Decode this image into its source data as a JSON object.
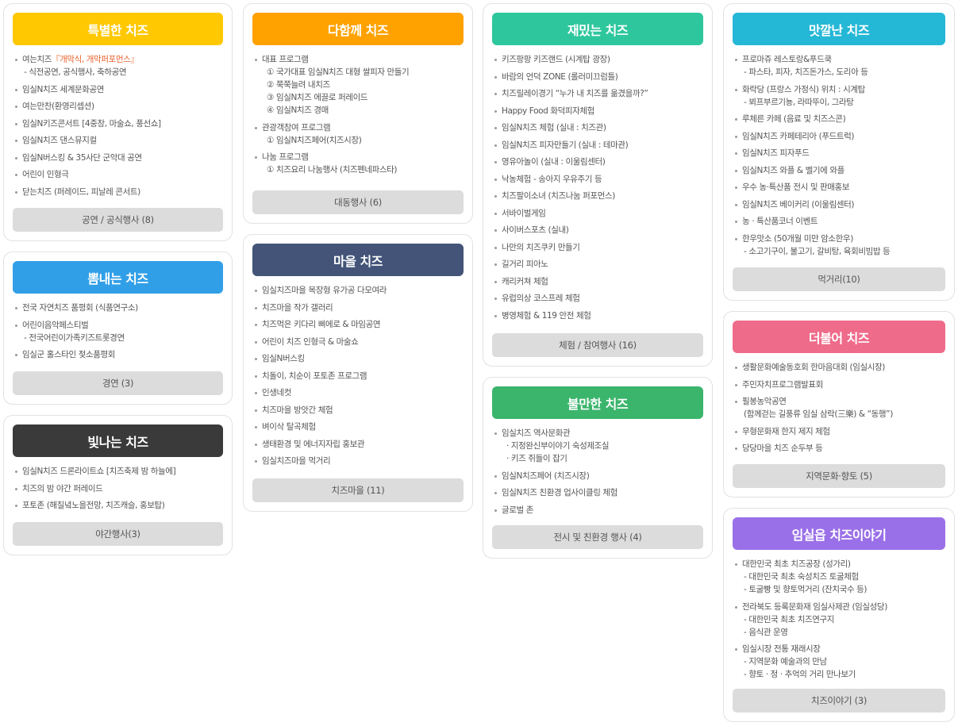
{
  "cards": [
    {
      "id": "special",
      "title": "특별한 치즈",
      "color": "#ffc800",
      "items": [
        {
          "text": "여는치즈",
          "highlight": "『개막식, 개막퍼포먼스』",
          "subs": [
            "- 식전공연, 공식행사, 축하공연"
          ]
        },
        {
          "text": "임실N치즈 세계문화공연"
        },
        {
          "text": "여는만찬(환영리셉션)"
        },
        {
          "text": "임실N키즈콘서트 [4중창, 마술쇼, 풍선쇼]"
        },
        {
          "text": "임실N치즈 댄스뮤지컬"
        },
        {
          "text": "임실N버스킹 & 35사단 군악대 공연"
        },
        {
          "text": "어린이 인형극"
        },
        {
          "text": "닫는치즈 (퍼레이드, 피날레 콘서트)"
        }
      ],
      "button": "공연 / 공식행사 (8)"
    },
    {
      "id": "boast",
      "title": "뽐내는 치즈",
      "color": "#319fe8",
      "items": [
        {
          "text": "전국 자연치즈 품평회 (식품연구소)"
        },
        {
          "text": "어린이음악페스티벌",
          "subs": [
            "- 전국어린이가족키즈트롯경연"
          ]
        },
        {
          "text": "임실군 홀스타인 젖소품평회"
        }
      ],
      "button": "경연 (3)"
    },
    {
      "id": "shine",
      "title": "빛나는 치즈",
      "color": "#3a3a3a",
      "items": [
        {
          "text": "임실N치즈 드론라이트쇼 [치즈축제 밤 하늘에]"
        },
        {
          "text": "치즈의 밤 야간 퍼레이드"
        },
        {
          "text": "포토존 (해질녘노을전망, 치즈캐슬, 홍보탑)"
        }
      ],
      "button": "야간행사(3)"
    },
    {
      "id": "together",
      "title": "다함께 치즈",
      "color": "#ffa200",
      "items": [
        {
          "text": "대표 프로그램",
          "subs": [
            "① 국가대표 임실N치즈 대형 쌀피자 만들기",
            "② 쭉쭉늘려 내치즈",
            "③ 임실N치즈 에끌로 퍼레이드",
            "④ 임실N치즈 경매"
          ]
        },
        {
          "text": "관광객참여 프로그램",
          "subs": [
            "① 임실N치즈페어(치즈시장)"
          ]
        },
        {
          "text": "나눔 프로그램",
          "subs": [
            "① 치즈요리 나눔행사 (치즈펜네파스타)"
          ]
        }
      ],
      "button": "대동행사 (6)"
    },
    {
      "id": "village",
      "title": "마을 치즈",
      "color": "#435478",
      "items": [
        {
          "text": "임실치즈마을 목장형 유가공 다모여라"
        },
        {
          "text": "치즈마을 작가 갤러리"
        },
        {
          "text": "치즈먹은 키다리 삐에로 & 마임공연"
        },
        {
          "text": "어린이 치즈 인형극 & 마술쇼"
        },
        {
          "text": "임실N버스킹"
        },
        {
          "text": "치돌이, 치순이 포토존 프로그램"
        },
        {
          "text": "인생네컷"
        },
        {
          "text": "치즈마을 방앗간 체험"
        },
        {
          "text": "벼이삭 탈곡체험"
        },
        {
          "text": "생태환경 및 에너지자립 홍보관"
        },
        {
          "text": "임실치즈마을 먹거리"
        }
      ],
      "button": "치즈마을 (11)"
    },
    {
      "id": "fun",
      "title": "재밌는 치즈",
      "color": "#2ec79d",
      "items": [
        {
          "text": "키즈팡팡 키즈랜드 (시계탑 광장)"
        },
        {
          "text": "바람의 언덕 ZONE (롤러미끄럼틀)"
        },
        {
          "text": "치즈릴레이경기 “누가 내 치즈를 옮겼을까?”"
        },
        {
          "text": "Happy Food 화덕피자체험"
        },
        {
          "text": "임실N치즈 체험 (실내 : 치즈관)"
        },
        {
          "text": "임실N치즈 피자만들기 (실내 : 테마관)"
        },
        {
          "text": "영유아놀이 (실내 : 이울림센터)"
        },
        {
          "text": "낙농체험 - 송아지 우유주기 등"
        },
        {
          "text": "치즈팔이소녀 (치즈나눔 퍼포먼스)"
        },
        {
          "text": "서바이벌게임"
        },
        {
          "text": "사이버스포츠 (실내)"
        },
        {
          "text": "나만의 치즈쿠키 만들기"
        },
        {
          "text": "길거리 피아노"
        },
        {
          "text": "캐리커쳐 체험"
        },
        {
          "text": "유럽의상 코스프레 체험"
        },
        {
          "text": "병영체험 & 119 안전 체험"
        }
      ],
      "button": "체험 / 참여행사 (16)"
    },
    {
      "id": "full",
      "title": "불만한 치즈",
      "color": "#3bb56c",
      "items": [
        {
          "text": "임실치즈 역사문화관",
          "subs": [
            "· 지정완신부이야기 숙성제조실",
            "· 키즈 쥐들이 잡기"
          ]
        },
        {
          "text": "임실N치즈페어 (치즈시장)"
        },
        {
          "text": "임실N치즈 친환경 업사이클링 체험"
        },
        {
          "text": "글로벌 존"
        }
      ],
      "button": "전시 및 친환경 행사 (4)"
    },
    {
      "id": "tasty",
      "title": "맛깔난 치즈",
      "color": "#25b7d6",
      "items": [
        {
          "text": "프로마쥬 레스토랑&푸드쿡",
          "subs": [
            "- 파스타, 피자, 치즈돈가스, 도리아 등"
          ]
        },
        {
          "text": "화락당 (프랑스 가정식) 위치 : 시계탑",
          "subs": [
            "- 뵈프부르기뇽, 라따뚜이, 그라탕"
          ]
        },
        {
          "text": "루체른 카페 (음료 및 치즈스콘)"
        },
        {
          "text": "임실N치즈 카페테리아 (푸드트럭)"
        },
        {
          "text": "임실N치즈 피자푸드"
        },
        {
          "text": "임실N치즈 와플 & 벨기에 와플"
        },
        {
          "text": "우수 농·특산품 전시 및 판매홍보"
        },
        {
          "text": "임실N치즈 베이커리 (이울림센터)"
        },
        {
          "text": "농 · 특산품코너 이벤트"
        },
        {
          "text": "한우맛소 (50개월 미만 암소한우)",
          "subs": [
            "- 소고기구이, 불고기, 갈비탕, 육회비빔밥 등"
          ]
        }
      ],
      "button": "먹거리(10)"
    },
    {
      "id": "with",
      "title": "더불어 치즈",
      "color": "#ef6b8a",
      "items": [
        {
          "text": "생활문화예술동호회 한마음대회 (임실시장)"
        },
        {
          "text": "주민자치프로그램발표회"
        },
        {
          "text": "필봉농악공연",
          "subs": [
            "(함께걷는 길풍류 임실 삼락(三樂) & “동행”)"
          ]
        },
        {
          "text": "무형문화재 한지 제지 체험"
        },
        {
          "text": "당당마을 치즈 순두부 등"
        }
      ],
      "button": "지역문화·향토 (5)"
    },
    {
      "id": "story",
      "title": "임실읍 치즈이야기",
      "color": "#9a70e8",
      "items": [
        {
          "text": "대한민국 최초 치즈공장 (성가리)",
          "subs": [
            "- 대한민국 최초 숙성치즈 토굴체험",
            "- 토굴빵 및 향토먹거리 (잔치국수 등)"
          ]
        },
        {
          "text": "전라북도 등록문화재 임실사제관 (임실성당)",
          "subs": [
            "- 대한민국 최초 치즈연구지",
            "- 음식관 운영"
          ]
        },
        {
          "text": "임실시장 전통 재래시장",
          "subs": [
            "- 지역문화 예술과의 만남",
            "- 향토 · 정 · 추억의 거리 만나보기"
          ]
        }
      ],
      "button": "치즈이야기 (3)"
    }
  ]
}
